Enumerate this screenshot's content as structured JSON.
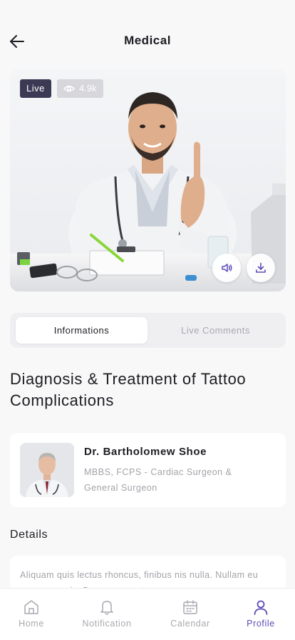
{
  "header": {
    "title": "Medical"
  },
  "video": {
    "live_label": "Live",
    "views": "4.9k"
  },
  "tabs": [
    {
      "label": "Informations",
      "active": true
    },
    {
      "label": "Live Comments",
      "active": false
    }
  ],
  "session": {
    "title": "Diagnosis & Treatment of Tattoo Complications"
  },
  "doctor": {
    "name": "Dr. Bartholomew Shoe",
    "specialty": "MBBS, FCPS - Cardiac Surgeon & General Surgeon"
  },
  "details": {
    "title": "Details",
    "text": "Aliquam quis lectus rhoncus, finibus nis nulla. Nullam eu neque mauris. Donec nec ante nec augue ornare"
  },
  "bottom_nav": [
    {
      "label": "Home",
      "icon": "home-icon",
      "active": false
    },
    {
      "label": "Notification",
      "icon": "bell-icon",
      "active": false
    },
    {
      "label": "Calendar",
      "icon": "calendar-icon",
      "active": false
    },
    {
      "label": "Profile",
      "icon": "profile-icon",
      "active": true
    }
  ],
  "colors": {
    "accent": "#5f4bb6",
    "live_badge": "#3b3a55",
    "muted_text": "#a3a3aa"
  }
}
